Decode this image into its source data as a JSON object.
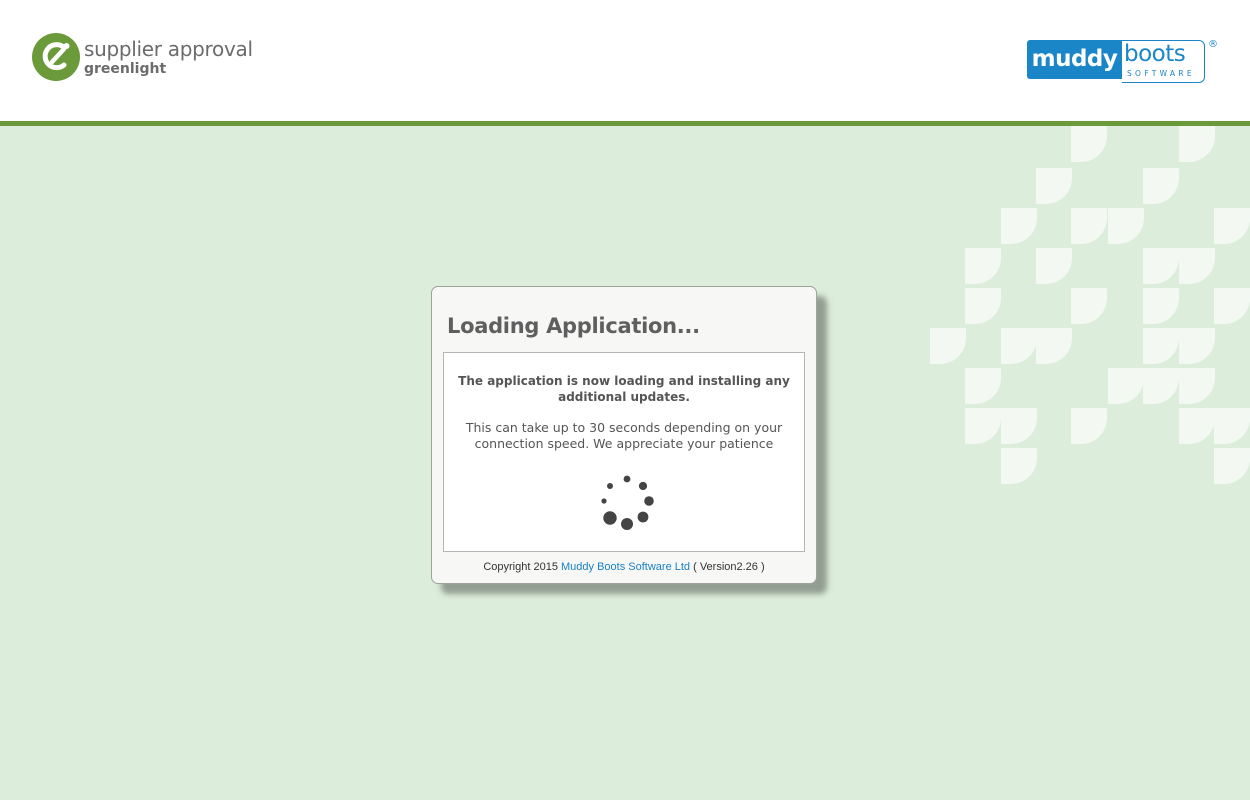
{
  "header": {
    "brand": {
      "title": "supplier approval",
      "subtitle": "greenlight"
    },
    "vendor_logo": {
      "word_left": "muddy",
      "word_right": "boots",
      "tagline": "SOFTWARE",
      "registered": "®"
    }
  },
  "loading_dialog": {
    "title": "Loading Application...",
    "message_main": "The application is now loading and installing any additional updates.",
    "message_sub": "This can take up to 30 seconds depending on your connection speed. We appreciate your patience",
    "spinner_icon": "loading-spinner-icon",
    "footer": {
      "copyright": "Copyright 2015",
      "company_link": "Muddy Boots Software Ltd",
      "version": "( Version2.26 )"
    }
  },
  "colors": {
    "background": "#ddeddb",
    "header_rule": "#6a9a3a",
    "brand_green": "#6a9a3a",
    "brand_blue": "#1a86c8",
    "link": "#1a7fc4"
  }
}
